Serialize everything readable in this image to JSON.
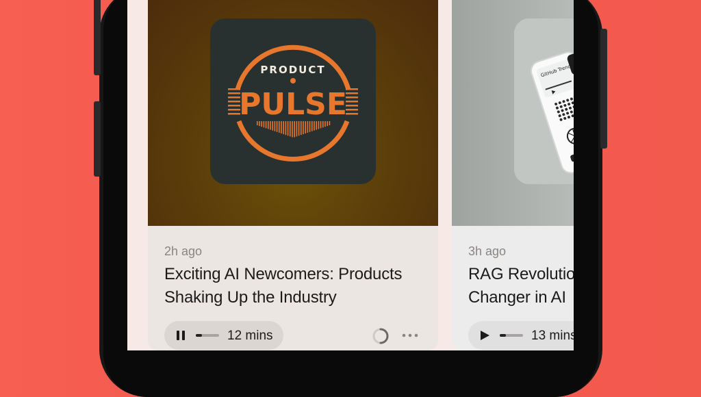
{
  "feed": {
    "cards": [
      {
        "art": {
          "brand_top": "PRODUCT",
          "brand_main": "PULSE",
          "accent_color": "#e8772e",
          "background_color": "#283130"
        },
        "time_ago": "2h ago",
        "title": "Exciting AI Newcomers: Products Shaking Up the Industry",
        "player": {
          "state": "playing",
          "control_icon": "pause-icon",
          "progress": 0.25,
          "duration": "12 mins"
        },
        "icons": [
          "loading-spinner-icon",
          "more-options-icon"
        ]
      },
      {
        "art": {
          "device_text": "GitHub Trending"
        },
        "time_ago": "3h ago",
        "title": "RAG Revolutio\nChanger in AI",
        "player": {
          "state": "paused",
          "control_icon": "play-icon",
          "progress": 0.25,
          "duration": "13 mins"
        }
      }
    ]
  },
  "colors": {
    "background": "#f4564c",
    "phone_frame": "#171718"
  }
}
